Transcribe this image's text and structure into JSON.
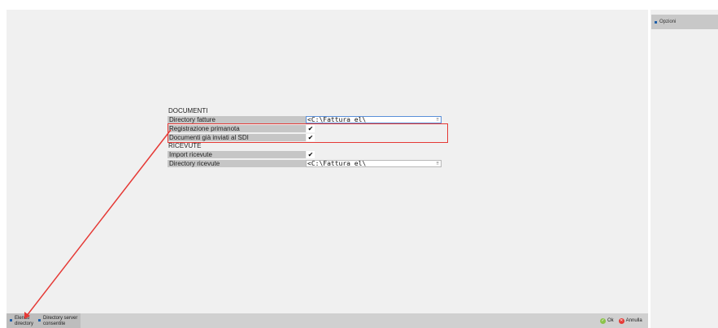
{
  "side": {
    "options_label": "Opzioni"
  },
  "form": {
    "section_documenti": "DOCUMENTI",
    "directory_fatture_label": "Directory fatture",
    "directory_fatture_value": "<C:\\Fattura el\\",
    "registrazione_label": "Registrazione primanota",
    "registrazione_checked": "✔",
    "documenti_sdi_label": "Documenti già inviati al SDI",
    "documenti_sdi_checked": "✔",
    "section_ricevute": "RICEVUTE",
    "import_ricevute_label": "Import ricevute",
    "import_ricevute_checked": "✔",
    "directory_ricevute_label": "Directory ricevute",
    "directory_ricevute_value": "<C:\\Fattura el\\",
    "ellipsis": "⠿"
  },
  "footer": {
    "elenco_line1": "Elenco",
    "elenco_line2": "directory",
    "server_line1": "Directory server",
    "server_line2": "consentite",
    "ok_label": "Ok",
    "annulla_label": "Annulla"
  },
  "colors": {
    "highlight": "#e53935",
    "accent": "#1f5fa8",
    "ok": "#8bc34a",
    "cancel": "#e53935"
  },
  "icons": [
    "ok-check-icon",
    "cancel-x-icon",
    "annotation-arrow"
  ]
}
